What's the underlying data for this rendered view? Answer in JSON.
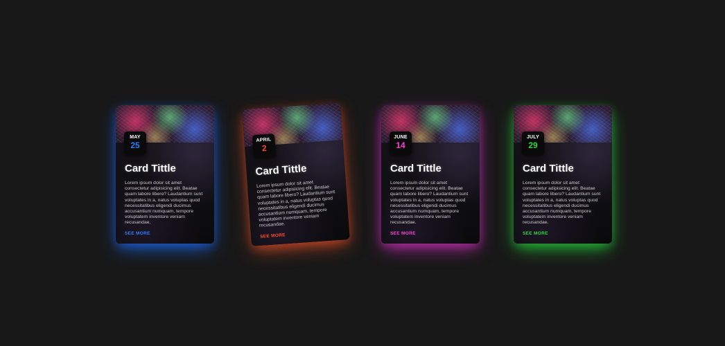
{
  "cards": [
    {
      "month": "MAY",
      "day": "25",
      "title": "Card Tittle",
      "text": "Lorem ipsum dolor sit amet consectetur adipisicing elit. Beatae quam labore libero? Laudantium sunt voluptates in a, natus voluptas quod necessitatibus eligendi ducimus accusantium numquam, tempore voluptatem inventore veniam recusandae.",
      "link": "SEE MORE",
      "accent": "#2a7fff"
    },
    {
      "month": "APRIL",
      "day": "2",
      "title": "Card Tittle",
      "text": "Lorem ipsum dolor sit amet consectetur adipisicing elit. Beatae quam labore libero? Laudantium sunt voluptates in a, natus voluptas quod necessitatibus eligendi ducimus accusantium numquam, tempore voluptatem inventore veniam recusandae.",
      "link": "SEE MORE",
      "accent": "#ff4a2a"
    },
    {
      "month": "JUNE",
      "day": "14",
      "title": "Card Tittle",
      "text": "Lorem ipsum dolor sit amet consectetur adipisicing elit. Beatae quam labore libero? Laudantium sunt voluptates in a, natus voluptas quod necessitatibus eligendi ducimus accusantium numquam, tempore voluptatem inventore veniam recusandae.",
      "link": "SEE MORE",
      "accent": "#ff3fd8"
    },
    {
      "month": "JULY",
      "day": "29",
      "title": "Card Tittle",
      "text": "Lorem ipsum dolor sit amet consectetur adipisicing elit. Beatae quam labore libero? Laudantium sunt voluptates in a, natus voluptas quod necessitatibus eligendi ducimus accusantium numquam, tempore voluptatem inventore veniam recusandae.",
      "link": "SEE MORE",
      "accent": "#2bd93a"
    }
  ]
}
